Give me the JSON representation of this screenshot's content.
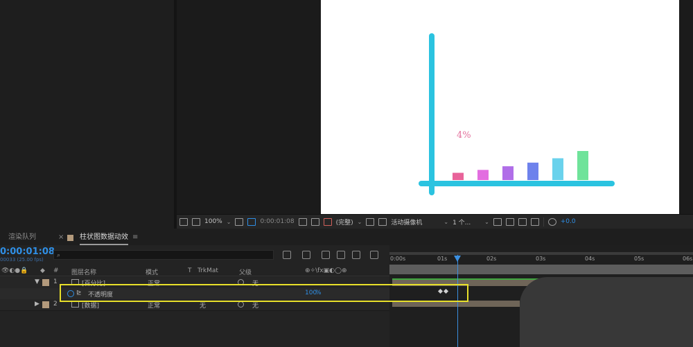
{
  "viewer_bar": {
    "zoom": "100%",
    "timecode": "0:00:01:08",
    "resolution": "(完整)",
    "camera": "活动摄像机",
    "views": "1 个...",
    "exposure": "+0.0"
  },
  "tabs": {
    "render_queue": "渲染队列",
    "composition": "柱状图数据动效",
    "menu_glyph": "≡",
    "close_glyph": "×"
  },
  "timeline": {
    "current_time": "0:00:01:08",
    "fps": "00033 (25.00 fps)",
    "search_placeholder": "⌕",
    "columns": {
      "num": "#",
      "layer_name": "图层名称",
      "mode": "模式",
      "t": "T",
      "trkmat": "TrkMat",
      "parent": "父级"
    },
    "ruler": [
      "0:00s",
      "01s",
      "02s",
      "03s",
      "04s",
      "05s",
      "06s"
    ],
    "layers": [
      {
        "num": "1",
        "name": "[百分比]",
        "mode": "正常",
        "trkmat": "",
        "parent": "无"
      },
      {
        "property": "不透明度",
        "value": "100",
        "unit": "%"
      },
      {
        "num": "2",
        "name": "[数据]",
        "mode": "正常",
        "trkmat": "无",
        "parent": "无"
      }
    ]
  },
  "chart_data": {
    "type": "bar",
    "title": "",
    "annotation": "4%",
    "axis_color": "#2bc3e0",
    "categories": [
      "",
      "",
      "",
      "",
      "",
      ""
    ],
    "values": [
      1.0,
      1.4,
      1.9,
      2.4,
      3.0,
      4.0
    ],
    "colors": [
      "#e8639a",
      "#e26ee0",
      "#b06ee8",
      "#6e82ec",
      "#6ad2ec",
      "#6fe39a"
    ],
    "ylim": [
      0,
      10
    ]
  },
  "colors": {
    "accent": "#2f8fe6",
    "highlight": "#e8e02a",
    "panel_bg": "#232323"
  }
}
